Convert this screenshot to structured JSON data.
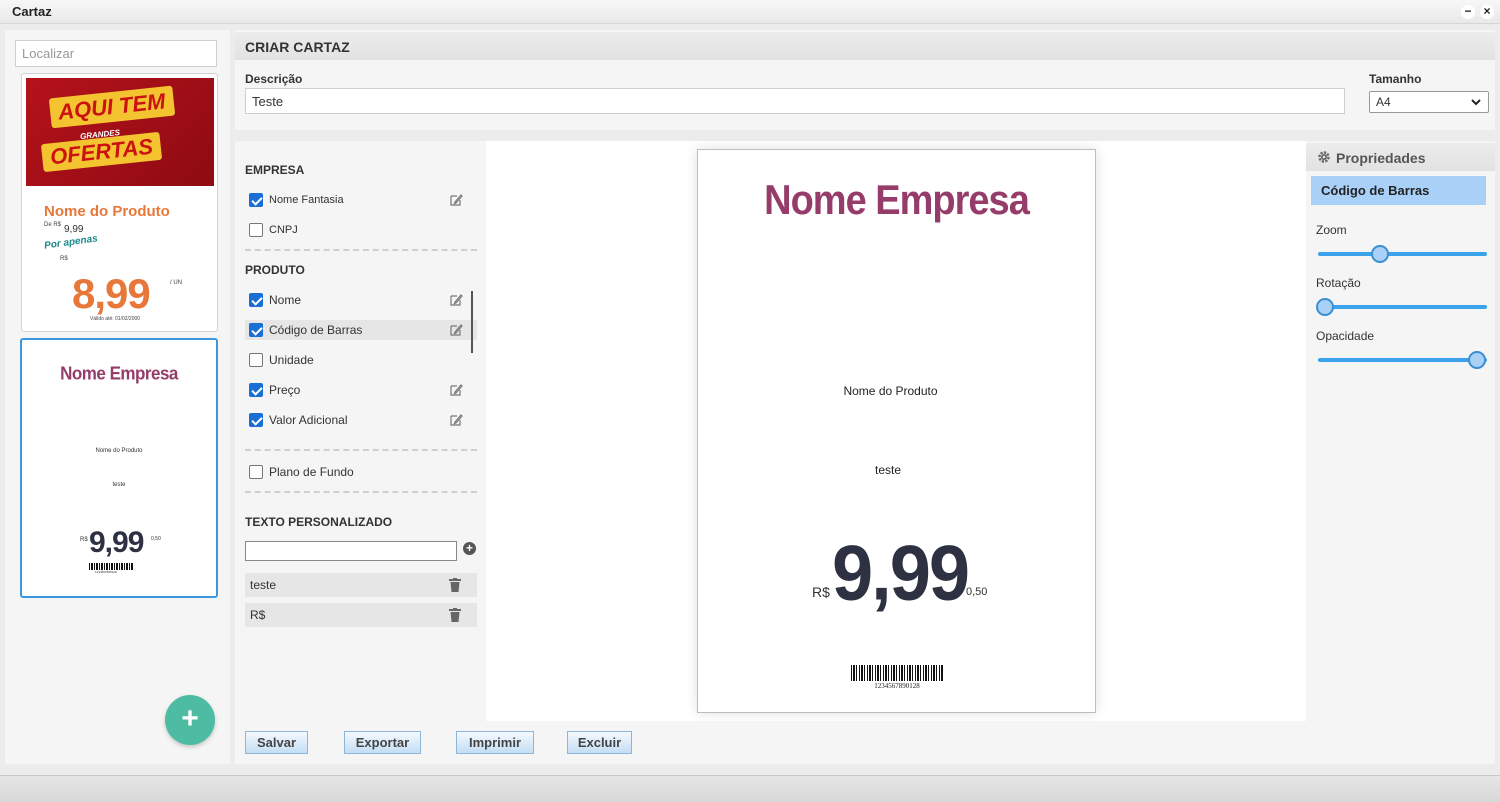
{
  "window": {
    "title": "Cartaz",
    "minimize": "−",
    "close": "×"
  },
  "left": {
    "search_placeholder": "Localizar",
    "add_button": "+",
    "thumb1": {
      "promo_line1": "AQUI TEM",
      "promo_line2": "GRANDES",
      "promo_line3": "OFERTAS",
      "product_name": "Nome do Produto",
      "de_rs": "De R$",
      "old_price": "9,99",
      "por_apenas": "Por apenas",
      "rs": "R$",
      "price": "8,99",
      "unit": "/ UN",
      "valid": "Válido até: 01/02/2000"
    },
    "thumb2": {
      "company": "Nome Empresa",
      "product": "Nome do Produto",
      "custom_text": "teste",
      "rs": "R$",
      "price": "9,99",
      "cents": "0,50",
      "barcode_number": "1234567890128"
    }
  },
  "header": {
    "title": "CRIAR CARTAZ",
    "description_label": "Descrição",
    "description_value": "Teste",
    "size_label": "Tamanho",
    "size_value": "A4"
  },
  "options": {
    "empresa_title": "EMPRESA",
    "empresa_items": [
      {
        "label": "Nome Fantasia",
        "checked": true
      },
      {
        "label": "CNPJ",
        "checked": false
      }
    ],
    "produto_title": "PRODUTO",
    "produto_items": [
      {
        "label": "Nome",
        "checked": true
      },
      {
        "label": "Código de Barras",
        "checked": true
      },
      {
        "label": "Unidade",
        "checked": false
      },
      {
        "label": "Preço",
        "checked": true
      },
      {
        "label": "Valor Adicional",
        "checked": true
      }
    ],
    "background_label": "Plano de Fundo",
    "custom_text_title": "TEXTO PERSONALIZADO",
    "custom_texts": [
      "teste",
      "R$"
    ]
  },
  "poster": {
    "company": "Nome Empresa",
    "product": "Nome do Produto",
    "custom_text": "teste",
    "rs": "R$",
    "price": "9,99",
    "cents": "0,50",
    "barcode_number": "1234567890128"
  },
  "properties": {
    "title": "Propriedades",
    "selected_element": "Código de Barras",
    "sliders": [
      {
        "label": "Zoom",
        "value": 0.36
      },
      {
        "label": "Rotação",
        "value": 0.0
      },
      {
        "label": "Opacidade",
        "value": 1.0
      }
    ]
  },
  "buttons": {
    "save": "Salvar",
    "export": "Exportar",
    "print": "Imprimir",
    "delete": "Excluir"
  },
  "colors": {
    "accent": "#3d97e0",
    "fab": "#4dbca3",
    "company": "#963c6a",
    "price": "#2e3142",
    "promo_orange": "#e8783a"
  }
}
